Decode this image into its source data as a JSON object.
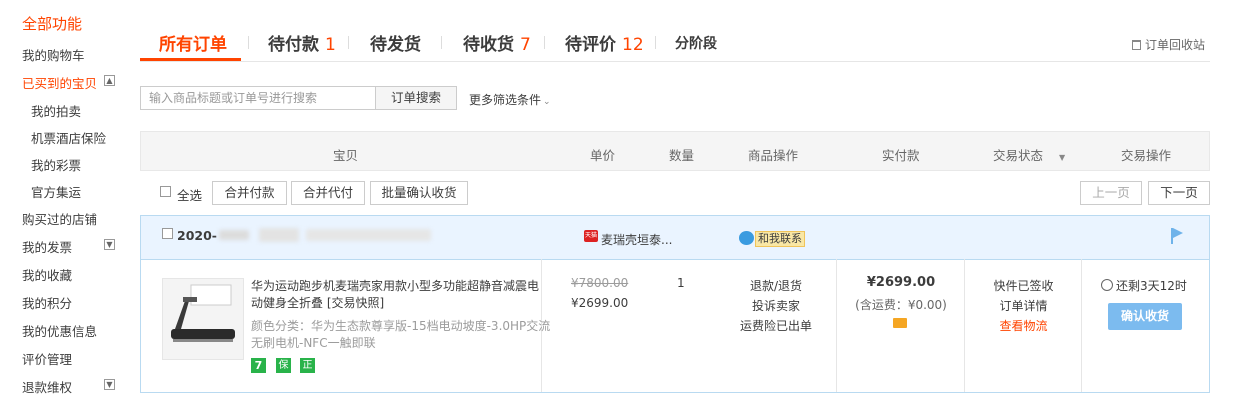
{
  "sidebar": {
    "title": "全部功能",
    "items": [
      {
        "label": "我的购物车"
      },
      {
        "label": "已买到的宝贝"
      },
      {
        "label": "我的拍卖"
      },
      {
        "label": "机票酒店保险"
      },
      {
        "label": "我的彩票"
      },
      {
        "label": "官方集运"
      },
      {
        "label": "购买过的店铺"
      },
      {
        "label": "我的发票"
      },
      {
        "label": "我的收藏"
      },
      {
        "label": "我的积分"
      },
      {
        "label": "我的优惠信息"
      },
      {
        "label": "评价管理"
      },
      {
        "label": "退款维权"
      }
    ]
  },
  "tabs": [
    {
      "label": "所有订单",
      "count": ""
    },
    {
      "label": "待付款",
      "count": "1"
    },
    {
      "label": "待发货",
      "count": ""
    },
    {
      "label": "待收货",
      "count": "7"
    },
    {
      "label": "待评价",
      "count": "12"
    },
    {
      "label": "分阶段",
      "count": ""
    }
  ],
  "recycle_label": "订单回收站",
  "search": {
    "placeholder": "输入商品标题或订单号进行搜索",
    "button": "订单搜索",
    "more_filters": "更多筛选条件"
  },
  "table_headers": [
    "宝贝",
    "单价",
    "数量",
    "商品操作",
    "实付款",
    "交易状态",
    "交易操作"
  ],
  "bulk": {
    "select_all": "全选",
    "merge_pay": "合并付款",
    "merge_proxy": "合并代付",
    "batch_confirm": "批量确认收货",
    "prev": "上一页",
    "next": "下一页"
  },
  "order": {
    "date_prefix": "2020-",
    "shop_name": "麦瑞壳垣泰...",
    "contact": "和我联系",
    "product_title": "华为运动跑步机麦瑞壳家用款小型多功能超静音减震电动健身全折叠 [交易快照]",
    "product_line1": "华为运动跑步机麦瑞壳家用款小型多功能超静音减震电",
    "product_line2": "动健身全折叠 [交易快照]",
    "sku_line1": "颜色分类：华为生态款尊享版-15档电动坡度-3.0HP交流",
    "sku_line2": "无刷电机-NFC一触即联",
    "service_icons": [
      "7",
      "保",
      "正"
    ],
    "original_price": "¥7800.00",
    "price": "¥2699.00",
    "quantity": "1",
    "ops": [
      "退款/退货",
      "投诉卖家",
      "运费险已出单"
    ],
    "paid": "¥2699.00",
    "shipping": "(含运费：¥0.00)",
    "status": "快件已签收",
    "detail": "订单详情",
    "logistics": "查看物流",
    "remaining": "还剩3天12时",
    "confirm_button": "确认收货"
  },
  "colors": {
    "accent": "#f40",
    "blue_button": "#7cbbef",
    "order_border": "#b9daf1"
  }
}
